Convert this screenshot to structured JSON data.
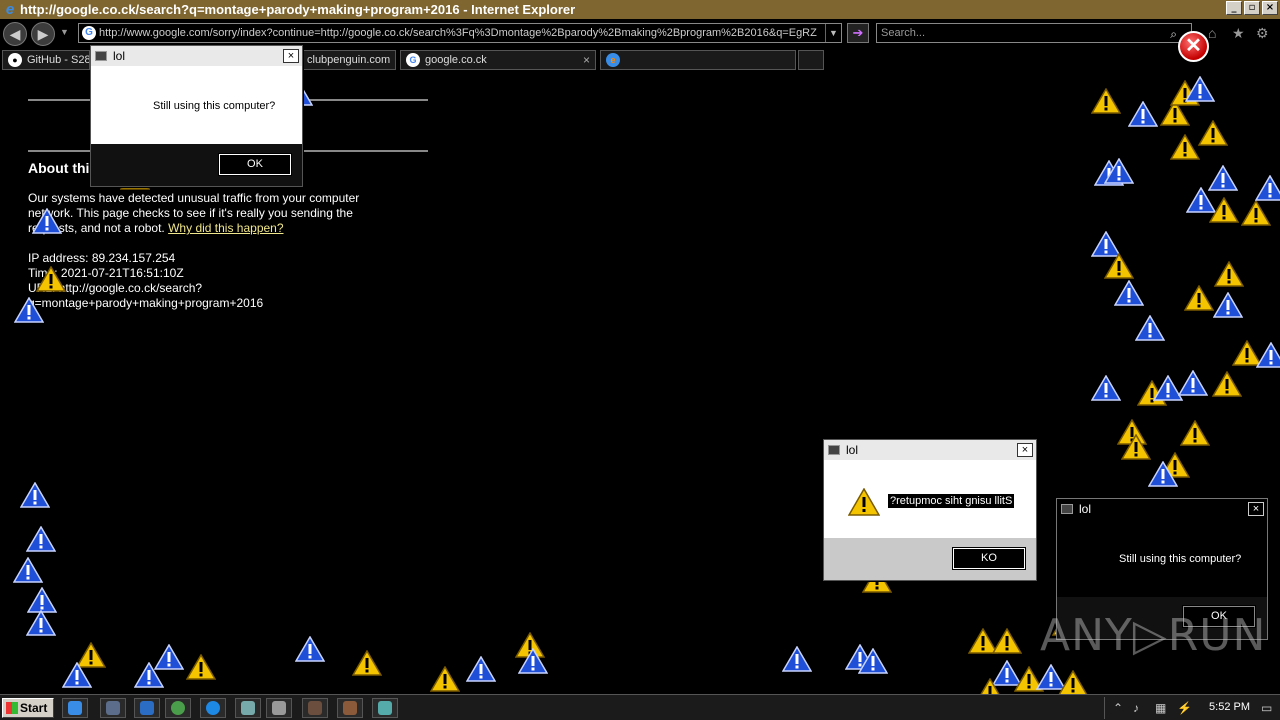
{
  "window": {
    "title": "http://google.co.ck/search?q=montage+parody+making+program+2016 - Internet Explorer",
    "controls": [
      "_",
      "▫",
      "×"
    ]
  },
  "nav": {
    "back_icon": "back-arrow-icon",
    "forward_icon": "forward-arrow-icon",
    "address": "http://www.google.com/sorry/index?continue=http://google.co.ck/search%3Fq%3Dmontage%2Bparody%2Bmaking%2Bprogram%2B2016&q=EgRZ",
    "search_placeholder": "Search..."
  },
  "tabs": [
    {
      "label": "GitHub - S28"
    },
    {
      "label": "clubpenguin.com"
    },
    {
      "label": "google.co.ck"
    },
    {
      "label": ""
    }
  ],
  "page": {
    "heading": "About this",
    "para1_line1": "Our systems have detected unusual traffic from your computer",
    "para1_line2": "network. This page checks to see if it's really you sending the",
    "para1_line3": "requests, and not a robot.",
    "why_link": "Why did this happen?",
    "ip": "IP address: 89.234.157.254",
    "time": "Time: 2021-07-21T16:51:10Z",
    "url1": "URL: http://google.co.ck/search?",
    "url2": "q=montage+parody+making+program+2016"
  },
  "dialogs": {
    "top_left": {
      "title": "lol",
      "message": "Still using this computer?",
      "button": "OK"
    },
    "center": {
      "title": "lol",
      "message": "?retupmoc siht gnisu llitS",
      "button": "KO"
    },
    "right": {
      "title": "lol",
      "message": "Still using this computer?",
      "button": "OK"
    }
  },
  "taskbar": {
    "start_label": "Start",
    "clock": "5:52 PM"
  },
  "watermark": "ANY▷RUN",
  "colors": {
    "titlebar": "#7f6630",
    "warning_yellow": "#f5c400",
    "warning_blue": "#1f4fd6"
  }
}
